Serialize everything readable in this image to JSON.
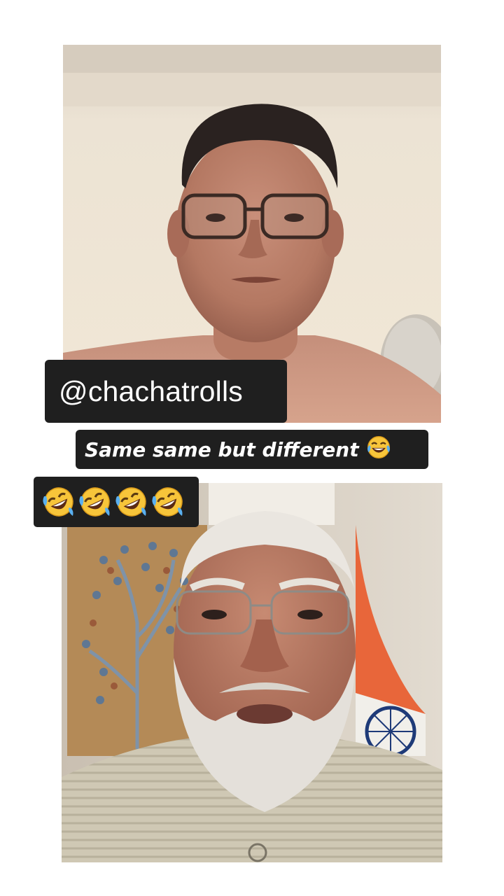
{
  "overlay": {
    "handle": "@chachatrolls",
    "caption": "Same same but different",
    "caption_emoji_icon": "face-with-tears-of-joy-icon",
    "emoji_row_icon": "rolling-on-floor-laughing-icon",
    "emoji_row_count": 4
  },
  "colors": {
    "page_background": "#ffffff",
    "label_background": "#1f1f1f",
    "label_text": "#ffffff",
    "flag_saffron": "#e8663a",
    "flag_chakra": "#1e3a78"
  }
}
